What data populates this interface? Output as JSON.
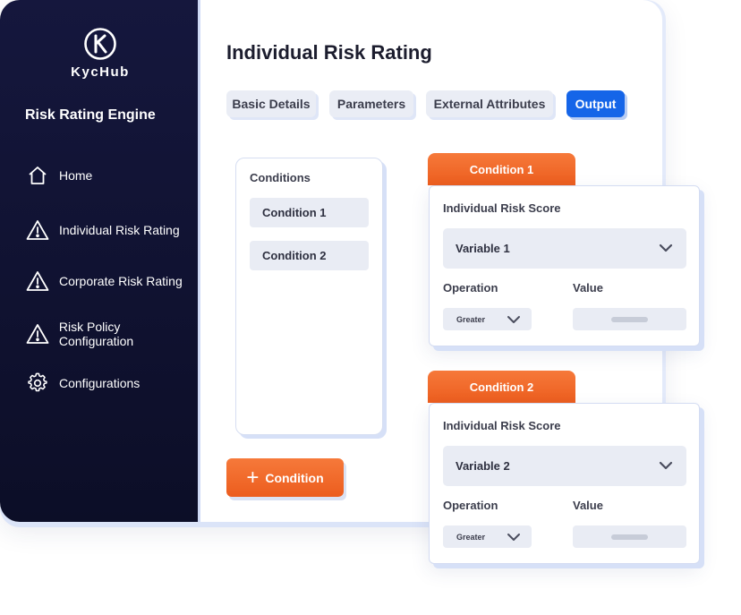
{
  "brand": {
    "name": "KycHub"
  },
  "sidebar": {
    "title": "Risk Rating Engine",
    "items": [
      {
        "label": "Home",
        "icon": "home-icon"
      },
      {
        "label": "Individual Risk Rating",
        "icon": "warning-icon"
      },
      {
        "label": "Corporate Risk Rating",
        "icon": "warning-icon"
      },
      {
        "label": "Risk Policy Configuration",
        "icon": "warning-icon"
      },
      {
        "label": "Configurations",
        "icon": "gear-icon"
      }
    ]
  },
  "main": {
    "title": "Individual Risk Rating",
    "tabs": [
      {
        "label": "Basic Details",
        "active": false
      },
      {
        "label": "Parameters",
        "active": false
      },
      {
        "label": "External Attributes",
        "active": false
      },
      {
        "label": "Output",
        "active": true
      }
    ],
    "conditions_panel": {
      "title": "Conditions",
      "items": [
        "Condition 1",
        "Condition 2"
      ]
    },
    "add_button_label": "Condition"
  },
  "condition_cards": [
    {
      "tab_label": "Condition 1",
      "score_label": "Individual Risk Score",
      "variable": "Variable 1",
      "operation_label": "Operation",
      "operation_value": "Greater",
      "value_label": "Value"
    },
    {
      "tab_label": "Condition 2",
      "score_label": "Individual Risk Score",
      "variable": "Variable 2",
      "operation_label": "Operation",
      "operation_value": "Greater",
      "value_label": "Value"
    }
  ],
  "colors": {
    "sidebar_bg": "#12143a",
    "accent_orange": "#f26a2b",
    "accent_blue": "#1565e8",
    "field_bg": "#e9ecf4"
  }
}
